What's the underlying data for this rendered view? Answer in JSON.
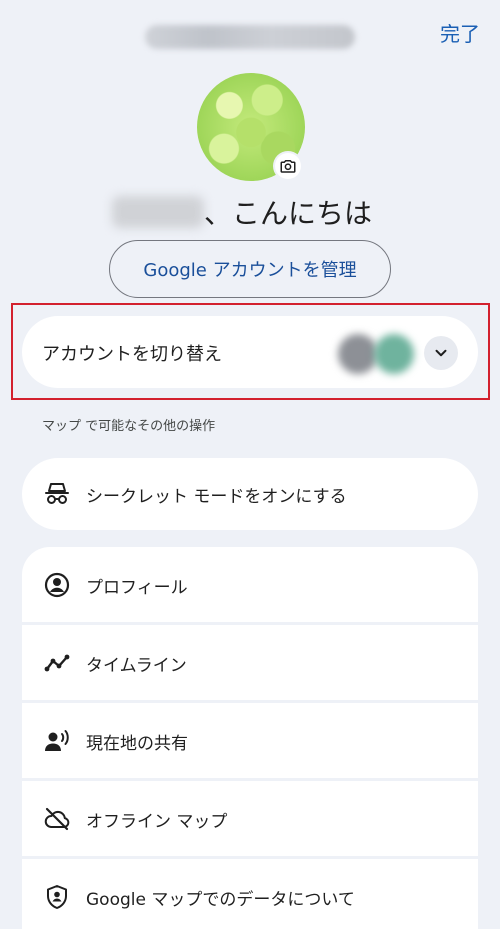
{
  "header": {
    "done_label": "完了"
  },
  "profile": {
    "greeting_suffix": "、こんにちは",
    "manage_account_label": "Google アカウントを管理"
  },
  "switch_account": {
    "label": "アカウントを切り替え"
  },
  "section_caption": "マップ で可能なその他の操作",
  "incognito": {
    "label": "シークレット モードをオンにする",
    "icon": "incognito-icon"
  },
  "menu": {
    "items": [
      {
        "label": "プロフィール",
        "icon": "profile-icon"
      },
      {
        "label": "タイムライン",
        "icon": "timeline-icon"
      },
      {
        "label": "現在地の共有",
        "icon": "location-sharing-icon"
      },
      {
        "label": "オフライン マップ",
        "icon": "offline-maps-icon"
      },
      {
        "label": "Google マップでのデータについて",
        "icon": "data-shield-icon"
      }
    ]
  },
  "colors": {
    "accent": "#1a5fb4",
    "background": "#eef1f7",
    "highlight": "#d3212e"
  }
}
